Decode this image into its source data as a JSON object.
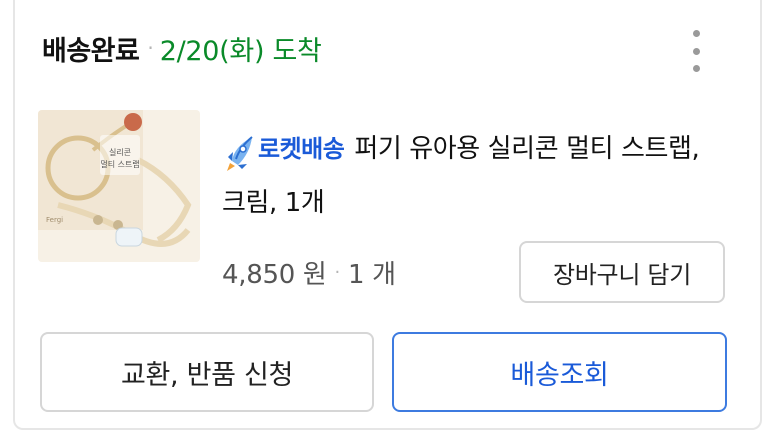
{
  "order": {
    "status": "배송완료",
    "separator": "·",
    "arrival": "2/20(화) 도착"
  },
  "product": {
    "badge_text": "로켓배송",
    "title": "퍼기 유아용 실리콘 멀티 스트랩, 크림, 1개",
    "thumbnail": {
      "brand_mark": "Fergi",
      "label_line1": "실리콘",
      "label_line2": "멀티 스트랩"
    },
    "price": "4,850 원",
    "price_separator": "·",
    "quantity": "1 개"
  },
  "buttons": {
    "add_to_cart": "장바구니 담기",
    "exchange_return": "교환, 반품 신청",
    "track_delivery": "배송조회"
  },
  "icons": {
    "menu": "more-vertical-icon",
    "rocket": "rocket-icon"
  },
  "colors": {
    "arrival_green": "#0a8a29",
    "rocket_blue": "#1a5ad8",
    "track_border": "#3d7be0"
  }
}
